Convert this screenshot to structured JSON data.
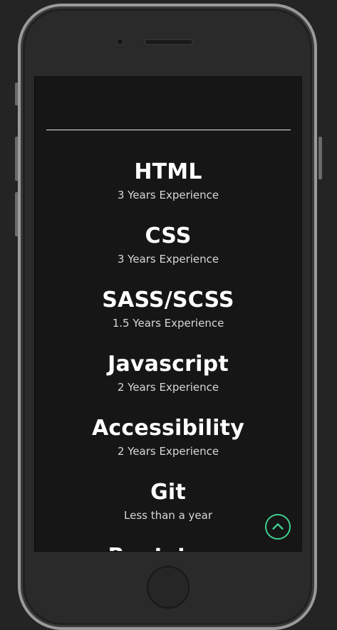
{
  "skills": [
    {
      "name": "HTML",
      "experience": "3 Years Experience"
    },
    {
      "name": "CSS",
      "experience": "3 Years Experience"
    },
    {
      "name": "SASS/SCSS",
      "experience": "1.5 Years Experience"
    },
    {
      "name": "Javascript",
      "experience": "2 Years Experience"
    },
    {
      "name": "Accessibility",
      "experience": "2 Years Experience"
    },
    {
      "name": "Git",
      "experience": "Less than a year"
    },
    {
      "name": "Bootstrap",
      "experience": ""
    }
  ],
  "scroll_top": {
    "icon": "chevron-up-icon",
    "color": "#3ecf8e"
  },
  "colors": {
    "screen_background": "#161616",
    "page_background": "#242424",
    "text": "#ffffff"
  }
}
